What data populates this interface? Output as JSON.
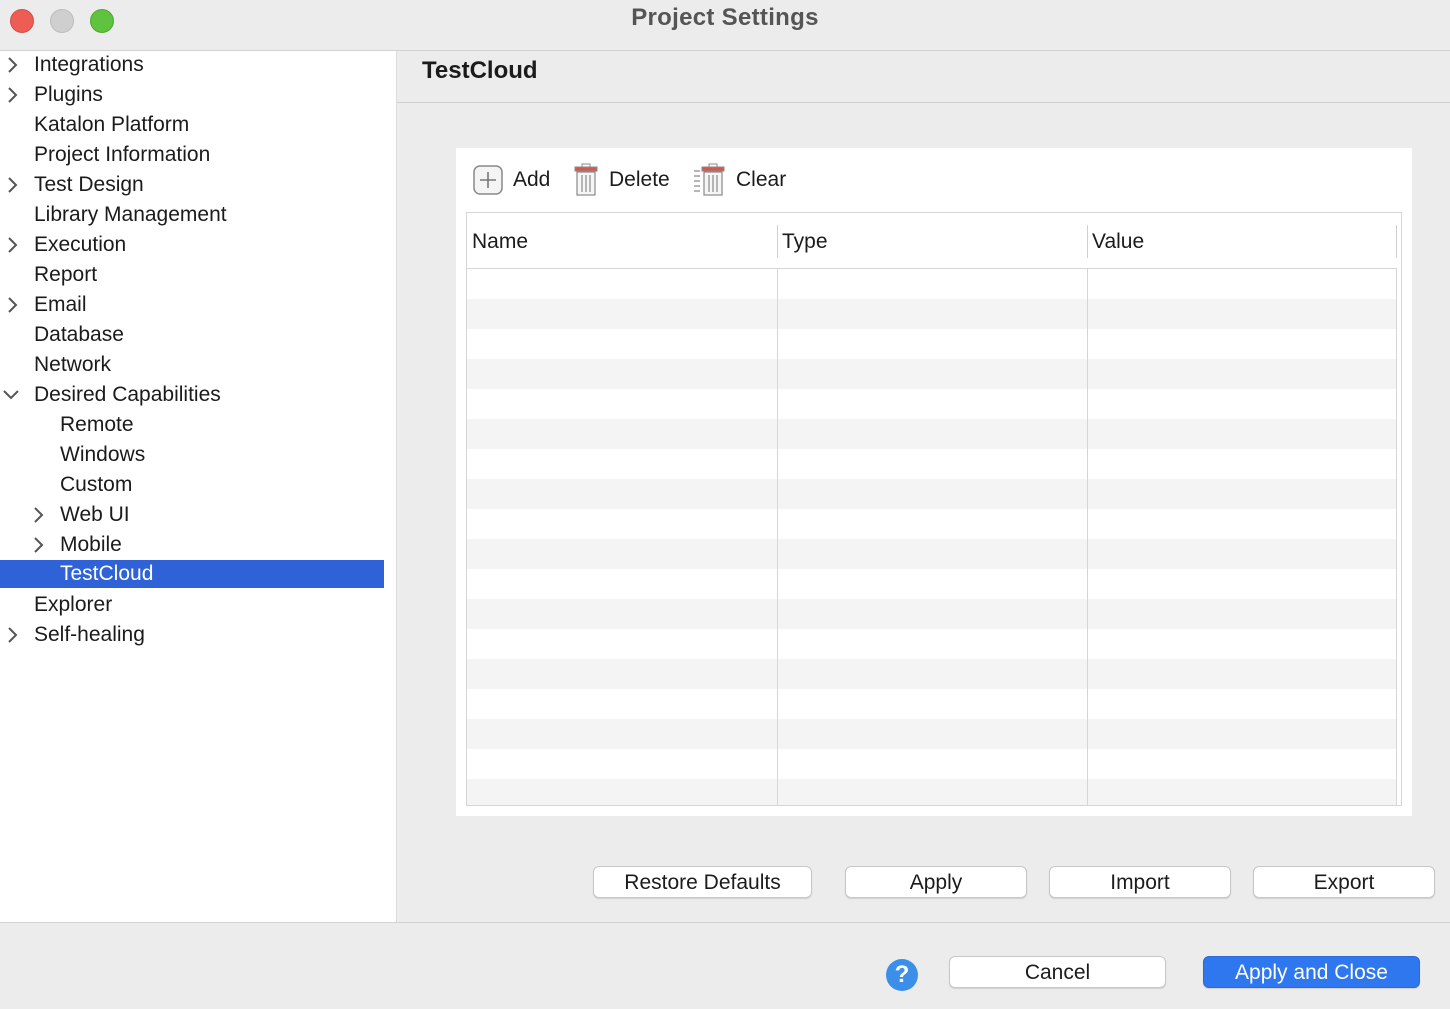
{
  "window": {
    "title": "Project Settings"
  },
  "sidebar": {
    "items": [
      {
        "label": "Integrations",
        "expander": "collapsed"
      },
      {
        "label": "Plugins",
        "expander": "collapsed"
      },
      {
        "label": "Katalon Platform",
        "expander": "none"
      },
      {
        "label": "Project Information",
        "expander": "none"
      },
      {
        "label": "Test Design",
        "expander": "collapsed"
      },
      {
        "label": "Library Management",
        "expander": "none"
      },
      {
        "label": "Execution",
        "expander": "collapsed"
      },
      {
        "label": "Report",
        "expander": "none"
      },
      {
        "label": "Email",
        "expander": "collapsed"
      },
      {
        "label": "Database",
        "expander": "none"
      },
      {
        "label": "Network",
        "expander": "none"
      },
      {
        "label": "Desired Capabilities",
        "expander": "expanded"
      },
      {
        "label": "Remote",
        "expander": "none"
      },
      {
        "label": "Windows",
        "expander": "none"
      },
      {
        "label": "Custom",
        "expander": "none"
      },
      {
        "label": "Web UI",
        "expander": "collapsed"
      },
      {
        "label": "Mobile",
        "expander": "collapsed"
      },
      {
        "label": "TestCloud",
        "expander": "none",
        "selected": true
      },
      {
        "label": "Explorer",
        "expander": "none"
      },
      {
        "label": "Self-healing",
        "expander": "collapsed"
      }
    ]
  },
  "main": {
    "title": "TestCloud",
    "toolbar": {
      "add_label": "Add",
      "delete_label": "Delete",
      "clear_label": "Clear"
    },
    "table": {
      "columns": [
        "Name",
        "Type",
        "Value"
      ],
      "rows": []
    },
    "buttons": {
      "restore_defaults": "Restore Defaults",
      "apply": "Apply",
      "import": "Import",
      "export": "Export"
    }
  },
  "footer": {
    "help_icon": "?",
    "cancel": "Cancel",
    "apply_and_close": "Apply and Close"
  },
  "colors": {
    "selection": "#2f62d6",
    "primary_button": "#2f77ef",
    "help_icon": "#3b8fe9"
  }
}
